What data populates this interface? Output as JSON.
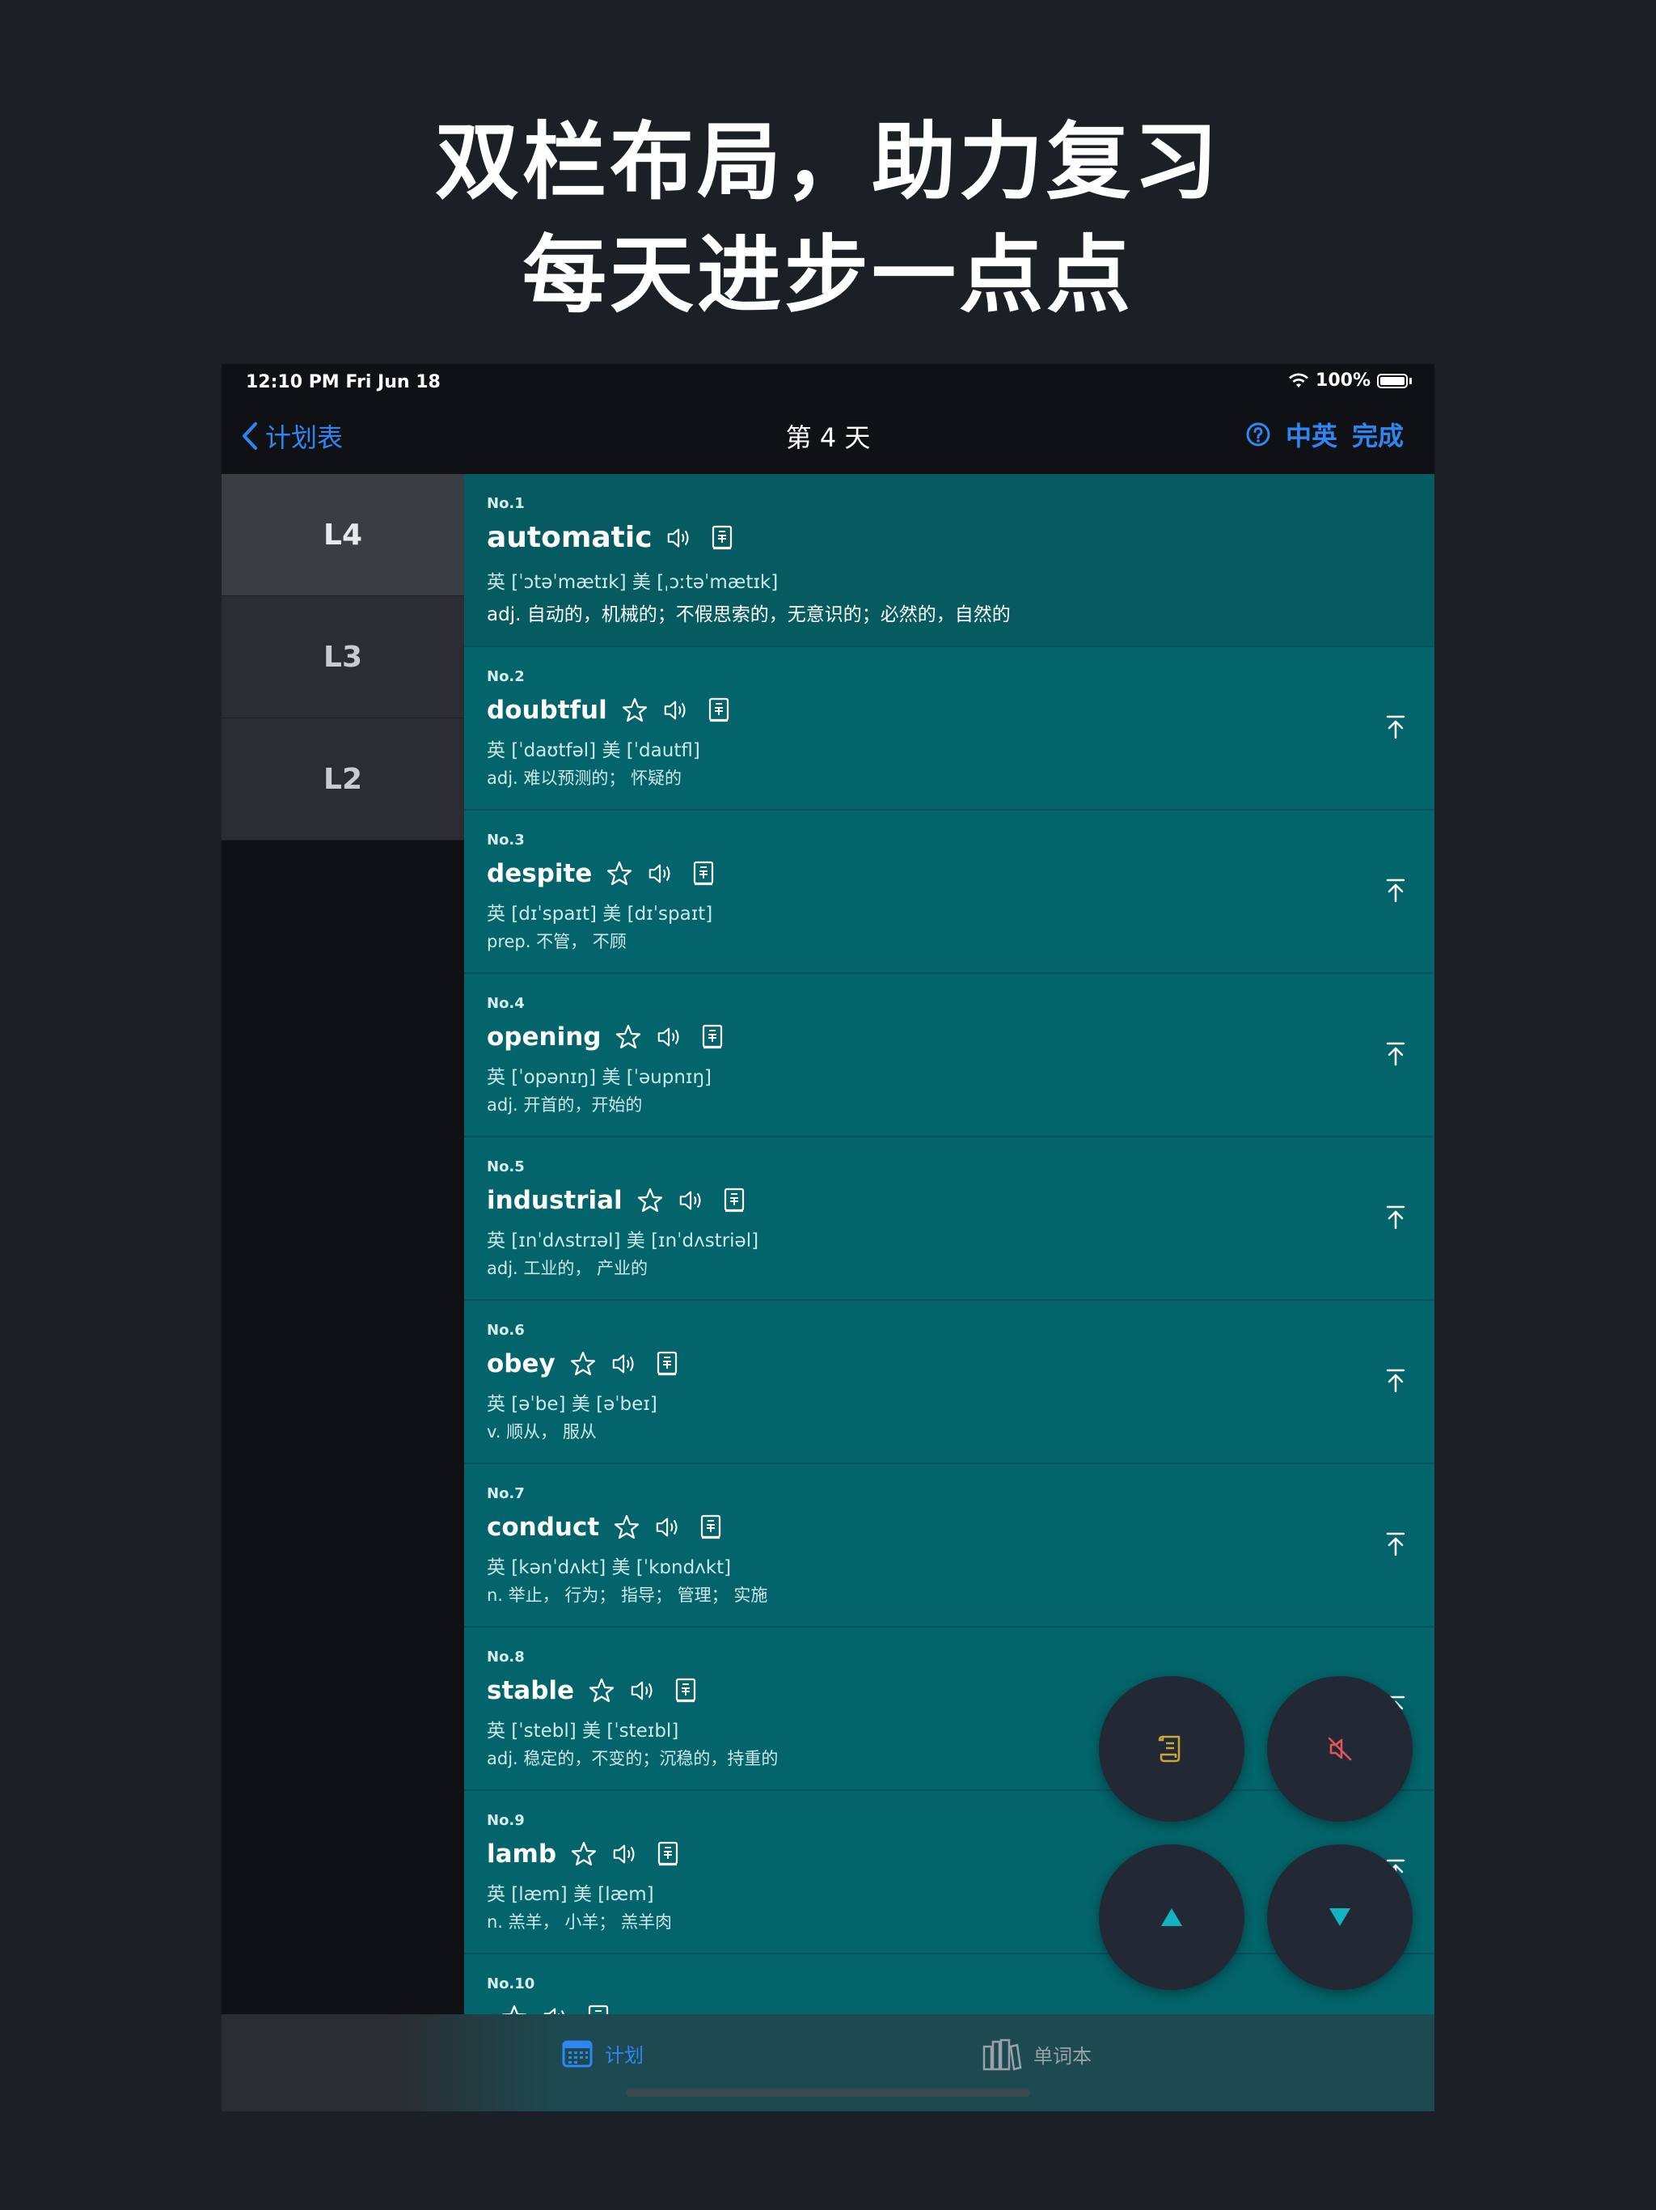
{
  "headline": {
    "line1": "双栏布局，助力复习",
    "line2": "每天进步一点点"
  },
  "status": {
    "time": "12:10 PM   Fri Jun 18",
    "battery": "100%"
  },
  "nav": {
    "back_label": "计划表",
    "title": "第 4 天",
    "lang_label": "中英",
    "done_label": "完成"
  },
  "sidebar": {
    "items": [
      {
        "label": "L4",
        "active": true
      },
      {
        "label": "L3",
        "active": false
      },
      {
        "label": "L2",
        "active": false
      }
    ]
  },
  "words": [
    {
      "no": "No.1",
      "word": "automatic",
      "phon": "英 [ˈɔtəˈmætɪk]  美 [ˌɔːtəˈmætɪk]",
      "def": "adj. 自动的，机械的；不假思索的，无意识的；必然的，自然的"
    },
    {
      "no": "No.2",
      "word": "doubtful",
      "phon": "英 [ˈdaʊtfəl]  美 [ˈdautfl]",
      "def": "adj.  难以预测的；  怀疑的"
    },
    {
      "no": "No.3",
      "word": "despite",
      "phon": "英 [dɪˈspaɪt]  美 [dɪˈspaɪt]",
      "def": "prep.  不管，  不顾"
    },
    {
      "no": "No.4",
      "word": "opening",
      "phon": "英 [ˈopənɪŋ]  美 [ˈəupnɪŋ]",
      "def": "adj. 开首的，开始的"
    },
    {
      "no": "No.5",
      "word": "industrial",
      "phon": "英 [ɪnˈdʌstrɪəl]  美 [ɪnˈdʌstriəl]",
      "def": "adj.  工业的，  产业的"
    },
    {
      "no": "No.6",
      "word": "obey",
      "phon": "英 [əˈbe]  美 [əˈbeɪ]",
      "def": "v.  顺从，  服从"
    },
    {
      "no": "No.7",
      "word": "conduct",
      "phon": "英 [kənˈdʌkt]  美 [ˈkɒndʌkt]",
      "def": "n.  举止，  行为；  指导；  管理；  实施"
    },
    {
      "no": "No.8",
      "word": "stable",
      "phon": "英 [ˈstebl]  美 [ˈsteɪbl]",
      "def": "adj. 稳定的，不变的；沉稳的，持重的"
    },
    {
      "no": "No.9",
      "word": "lamb",
      "phon": "英 [læm]  美 [læm]",
      "def": "n.  羔羊，  小羊；  羔羊肉"
    },
    {
      "no": "No.10",
      "word": "",
      "phon": "",
      "def": ""
    }
  ],
  "tabs": {
    "plan": "计划",
    "book": "单词本"
  },
  "colors": {
    "accent": "#2f86f2",
    "list_bg": "#03646b",
    "fab_bg": "#222834",
    "fab_note": "#c9a53a",
    "fab_mute": "#e0565b",
    "fab_arrow": "#14b3c1"
  }
}
